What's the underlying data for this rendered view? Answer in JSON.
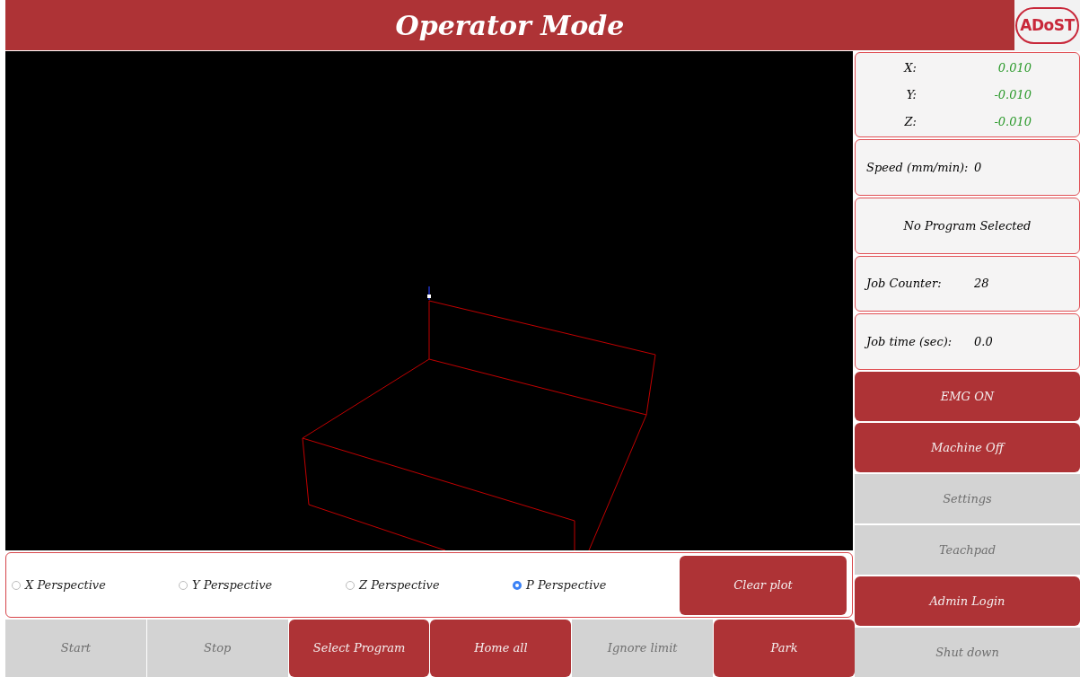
{
  "header": {
    "title": "Operator Mode",
    "logo": "ADoST"
  },
  "position": [
    {
      "axis": "X:",
      "value": "0.010"
    },
    {
      "axis": "Y:",
      "value": "-0.010"
    },
    {
      "axis": "Z:",
      "value": "-0.010"
    }
  ],
  "info": [
    {
      "kind": "pair",
      "label": "Speed (mm/min):",
      "value": "0"
    },
    {
      "kind": "single",
      "label": "No Program Selected"
    },
    {
      "kind": "pair",
      "label": "Job Counter:",
      "value": "28"
    },
    {
      "kind": "pair",
      "label": "Job time (sec):",
      "value": "0.0"
    }
  ],
  "side_buttons": [
    {
      "label": "EMG ON",
      "disabled": false
    },
    {
      "label": "Machine Off",
      "disabled": false
    },
    {
      "label": "Settings",
      "disabled": true
    },
    {
      "label": "Teachpad",
      "disabled": true
    },
    {
      "label": "Admin Login",
      "disabled": false
    },
    {
      "label": "Shut down",
      "disabled": true
    }
  ],
  "perspectives": [
    {
      "label": "X Perspective",
      "selected": false
    },
    {
      "label": "Y Perspective",
      "selected": false
    },
    {
      "label": "Z Perspective",
      "selected": false
    },
    {
      "label": "P Perspective",
      "selected": true
    }
  ],
  "clear_button": "Clear plot",
  "bottom_buttons": [
    {
      "label": "Start",
      "disabled": true
    },
    {
      "label": "Stop",
      "disabled": true
    },
    {
      "label": "Select Program",
      "disabled": false
    },
    {
      "label": "Home all",
      "disabled": false
    },
    {
      "label": "Ignore limit",
      "disabled": true
    },
    {
      "label": "Park",
      "disabled": false
    }
  ]
}
